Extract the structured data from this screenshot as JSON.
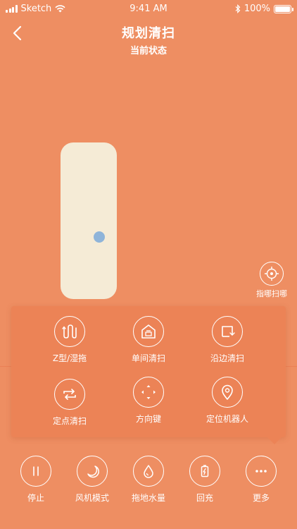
{
  "status_bar": {
    "carrier": "Sketch",
    "time": "9:41 AM",
    "battery": "100%",
    "battery_level": 1.0
  },
  "header": {
    "title": "规划清扫",
    "subtitle": "当前状态"
  },
  "locate": {
    "label": "指哪扫哪"
  },
  "mode_panel": {
    "items": [
      {
        "label": "Z型/湿拖",
        "icon": "zigzag-icon"
      },
      {
        "label": "单间清扫",
        "icon": "house-icon"
      },
      {
        "label": "沿边清扫",
        "icon": "edge-icon"
      },
      {
        "label": "定点清扫",
        "icon": "repeat-icon"
      },
      {
        "label": "方向键",
        "icon": "direction-pad-icon"
      },
      {
        "label": "定位机器人",
        "icon": "location-pin-icon"
      }
    ]
  },
  "bottom_bar": {
    "items": [
      {
        "label": "停止",
        "icon": "pause-icon"
      },
      {
        "label": "风机模式",
        "icon": "moon-icon"
      },
      {
        "label": "拖地水量",
        "icon": "water-drop-icon"
      },
      {
        "label": "回充",
        "icon": "battery-charge-icon"
      },
      {
        "label": "更多",
        "icon": "more-icon"
      }
    ]
  },
  "colors": {
    "background": "#EE8E62",
    "panel": "#EC8356",
    "map_room": "#F5EBD6",
    "robot": "#8FB4D9"
  }
}
